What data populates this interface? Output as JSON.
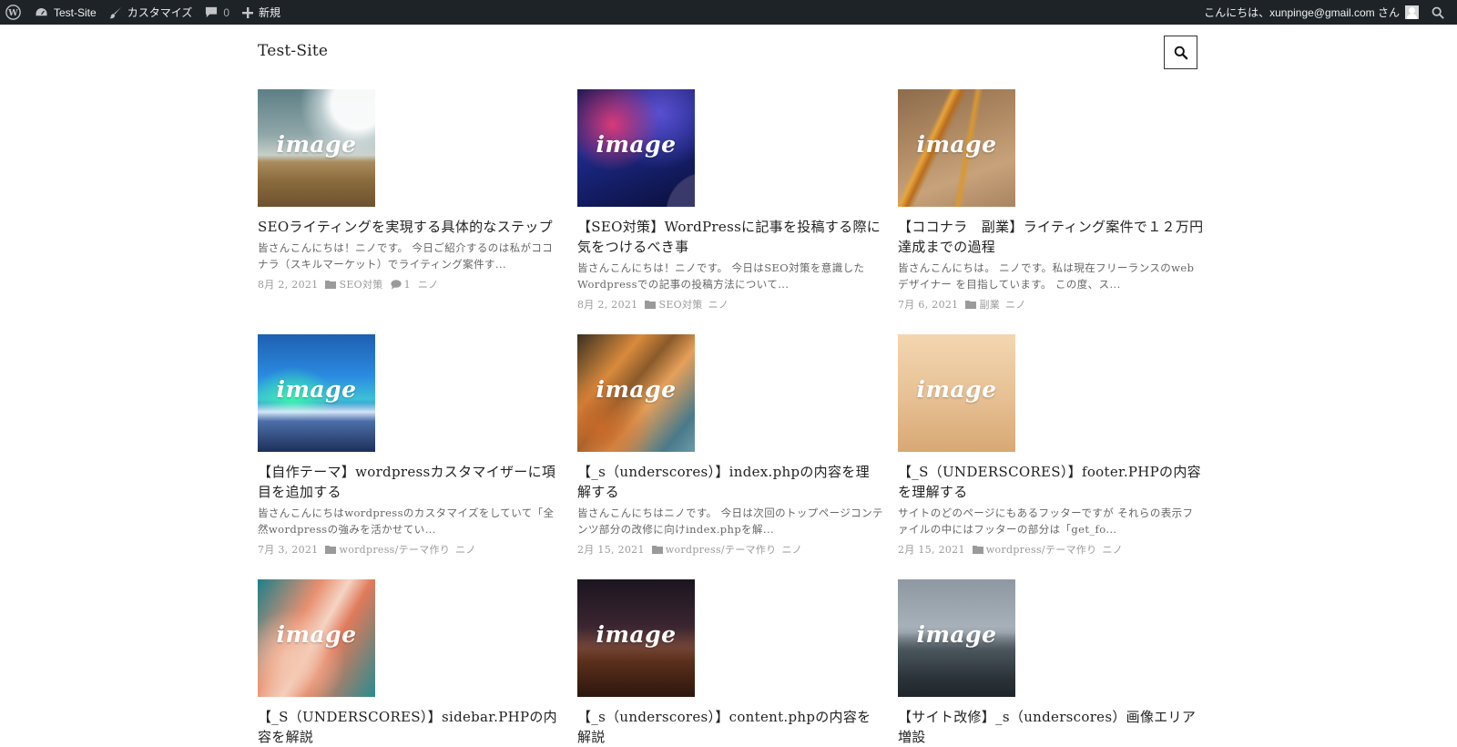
{
  "admin_bar": {
    "site_name": "Test-Site",
    "customize_label": "カスタマイズ",
    "comments_count": "0",
    "new_label": "新規",
    "greeting": "こんにちは、xunpinge@gmail.com さん"
  },
  "header": {
    "site_title": "Test-Site"
  },
  "thumbnail_text": "image",
  "posts": [
    {
      "title": "SEOライティングを実現する具体的なステップ",
      "excerpt": "皆さんこんにちは！ニノです。 今日ご紹介するのは私がココナラ（スキルマーケット）でライティング案件す...",
      "date": "8月 2, 2021",
      "category": "SEO対策",
      "comments": "1",
      "author": "ニノ"
    },
    {
      "title": "【SEO対策】WordPressに記事を投稿する際に気をつけるべき事",
      "excerpt": "皆さんこんにちは！ニノです。 今日はSEO対策を意識したWordpressでの記事の投稿方法について...",
      "date": "8月 2, 2021",
      "category": "SEO対策",
      "author": "ニノ"
    },
    {
      "title": "【ココナラ　副業】ライティング案件で１２万円達成までの過程",
      "excerpt": "皆さんこんにちは。 ニノです。私は現在フリーランスのwebデザイナー を目指しています。 この度、ス...",
      "date": "7月 6, 2021",
      "category": "副業",
      "author": "ニノ"
    },
    {
      "title": "【自作テーマ】wordpressカスタマイザーに項目を追加する",
      "excerpt": "皆さんこんにちはwordpressのカスタマイズをしていて「全然wordpressの強みを活かせてい...",
      "date": "7月 3, 2021",
      "category": "wordpress/テーマ作り",
      "author": "ニノ"
    },
    {
      "title": "【_s（underscores）】index.phpの内容を理解する",
      "excerpt": "皆さんこんにちはニノです。 今日は次回のトップページコンテンツ部分の改修に向けindex.phpを解...",
      "date": "2月 15, 2021",
      "category": "wordpress/テーマ作り",
      "author": "ニノ"
    },
    {
      "title": "【_S（UNDERSCORES）】footer.PHPの内容を理解する",
      "excerpt": "サイトのどのページにもあるフッターですが それらの表示ファイルの中にはフッターの部分は「get_fo...",
      "date": "2月 15, 2021",
      "category": "wordpress/テーマ作り",
      "author": "ニノ"
    },
    {
      "title": "【_S（UNDERSCORES）】sidebar.PHPの内容を解説",
      "excerpt": "",
      "date": "",
      "category": "",
      "author": ""
    },
    {
      "title": "【_s（underscores）】content.phpの内容を解説",
      "excerpt": "",
      "date": "",
      "category": "",
      "author": ""
    },
    {
      "title": "【サイト改修】_s（underscores）画像エリア増設",
      "excerpt": "",
      "date": "",
      "category": "",
      "author": ""
    }
  ]
}
